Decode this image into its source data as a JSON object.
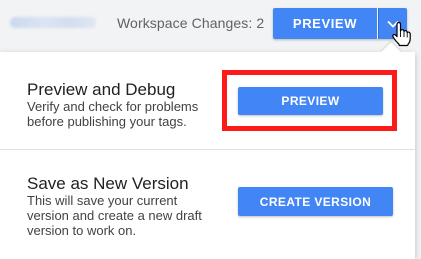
{
  "header": {
    "workspace_name": "",
    "workspace_changes": "Workspace Changes: 2",
    "preview_button": "PREVIEW",
    "dropdown_icon": "chevron-down-icon"
  },
  "menu": {
    "preview_debug": {
      "title": "Preview and Debug",
      "description": "Verify and check for problems before publishing your tags.",
      "button": "PREVIEW"
    },
    "new_version": {
      "title": "Save as New Version",
      "description": "This will save your current version and create a new draft version to work on.",
      "button": "CREATE VERSION"
    }
  },
  "colors": {
    "accent": "#4285f4",
    "highlight": "#ff1a1a"
  }
}
